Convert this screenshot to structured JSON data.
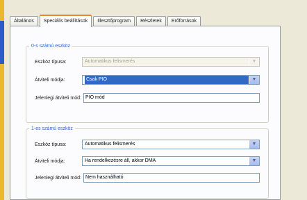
{
  "tabs": [
    {
      "label": "Általános"
    },
    {
      "label": "Speciális beállítások"
    },
    {
      "label": "Illesztőprogram"
    },
    {
      "label": "Részletek"
    },
    {
      "label": "Erőforrások"
    }
  ],
  "device0": {
    "title": "0-s számú eszköz",
    "device_type_label": "Eszköz típusa:",
    "device_type_value": "Automatikus felismerés",
    "transfer_mode_label": "Átviteli módja:",
    "transfer_mode_value": "Csak PIO",
    "current_mode_label": "Jelenlegi átviteli mód:",
    "current_mode_value": "PIO mód"
  },
  "device1": {
    "title": "1-es számú eszköz",
    "device_type_label": "Eszköz típusa:",
    "device_type_value": "Automatikus felismerés",
    "transfer_mode_label": "Átviteli módja:",
    "transfer_mode_value": "Ha rendelkezésre áll, akkor DMA",
    "current_mode_label": "Jelenlegi átviteli mód:",
    "current_mode_value": "Nem használható"
  },
  "colors": {
    "selection": "#316ac5",
    "active_tab_accent": "#e68b2c",
    "group_title": "#3060d0"
  }
}
